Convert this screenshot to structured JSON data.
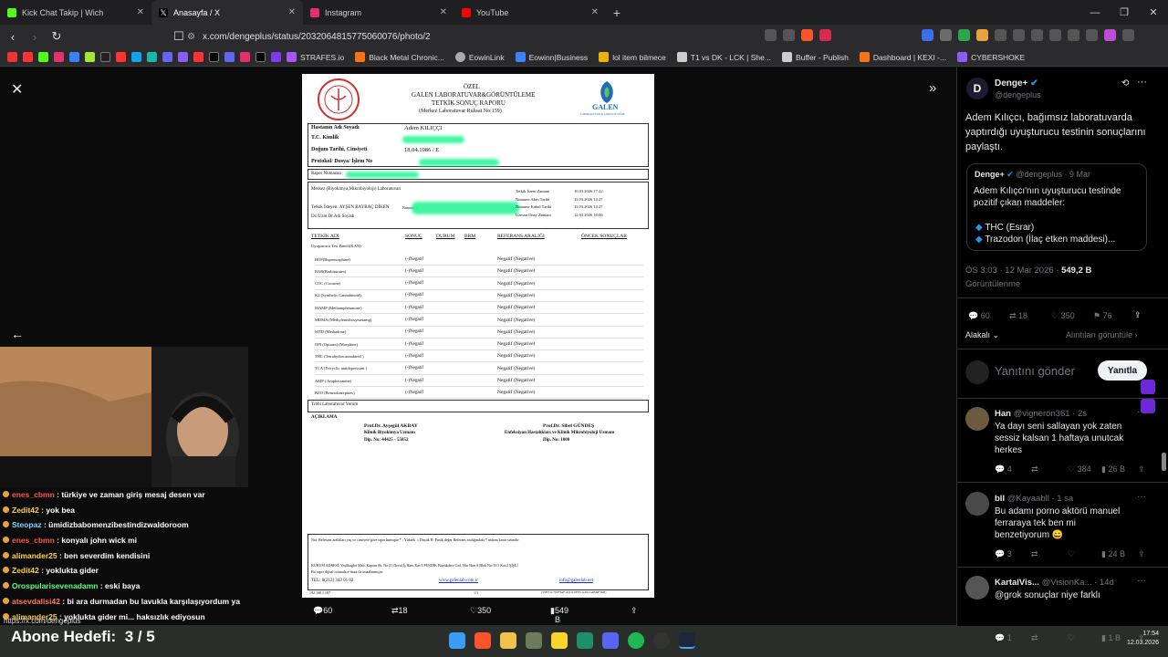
{
  "browser": {
    "tabs": [
      {
        "label": "Kick Chat Takip | Wich",
        "color": "#53fc18"
      },
      {
        "label": "Anasayfa / X",
        "color": "#ffffff"
      },
      {
        "label": "Instagram",
        "color": "#e1306c"
      },
      {
        "label": "YouTube",
        "color": "#ff0000"
      }
    ],
    "url": "x.com/dengeplus/status/2032064815775060076/photo/2",
    "bookmarks": [
      "STRAFES.io",
      "Black Metal Chronic...",
      "EowinLink",
      "Eowinn|Business",
      "lol item bilmece",
      "T1 vs DK - LCK | She...",
      "Buffer - Publish",
      "Dashboard | KEXI -...",
      "CYBERSHOKE"
    ]
  },
  "report": {
    "header": [
      "ÖZEL",
      "GALEN LABORATUVAR&GÖRÜNTÜLEME",
      "TETKİK SONUÇ RAPORU",
      "(Merkez Laboratuvar Ruhsat No:159)"
    ],
    "logo_text": "GALEN",
    "logo_sub": "LABORATUVAR & GÖRÜNTÜLEME",
    "patient_labels": [
      "Hastanın Adı Soyadı",
      "T.C. Kimlik",
      "Doğum Tarihi, Cinsiyeti",
      "Protokol/ Dosya/ İşlem No"
    ],
    "patient_name": "Adem KILIÇÇI",
    "patient_dob": "18.04.1986 /   E",
    "report_no": "Rapor Numarası",
    "lab": "Merkez (Biyokimya,Mikrobiyoloji) Laboratuvarı",
    "requester": "Tetkik İsteyen: AYŞEN BAYRAÇ DİKEN",
    "requester_extra": "Numune T.",
    "doctor": "Dr./Uzm.Dr.Adı Soyadı",
    "times": [
      {
        "label": "Tetkik İstem Zamanı",
        "value": "10.03.2026 17:22"
      },
      {
        "label": "Numune Alım Tarihi",
        "value": "11.03.2026 14:27"
      },
      {
        "label": "Numune Kabul Tarihi",
        "value": "11.03.2026 14:27"
      },
      {
        "label": "Uzman Onay Zamanı",
        "value": "12.03.2026 10:06"
      }
    ],
    "columns": [
      "TETKİK ADI",
      "SONUÇ",
      "DURUM",
      "BRM",
      "REFERANS ARALIĞI",
      "ÖNCEK SONUÇLAR"
    ],
    "panel": "Uyuşturucu Test Paneli(KAN)",
    "tests": [
      "BUP(Buprenorphine)",
      "BAR(Barbiturates)",
      "COC (Cocaine)",
      "K2 (Synthetic Cannabinoid)",
      "MAMP (Methamphetamine)",
      "MDMA (Methylenedioxymetamp)",
      "MTD (Methadone)",
      "OPI (Opiates) (Morphine)",
      "THC (Tetrahydrocannabinol )",
      "TCA (Tricyclic antidepressant )",
      "AMP ( Amphetamine)",
      "BZO (Benzodiazepines)"
    ],
    "result": "(-)Negatif",
    "reference": "Negatif (Negative)",
    "footer_row": "Tıbbi Laboratuvar Yorum",
    "aciklama": "AÇIKLAMA",
    "sign1": [
      "Prof.Dr. Ayşegül AKBAY",
      "Klinik Biyokimya Uzmanı",
      "Dip. No: 44425 - 55852"
    ],
    "sign2": [
      "Prof.Dr. Sibel GÜNDEŞ",
      "Enfeksiyon Hastalıkları ve Klinik Mikrobiyoloji Uzmanı",
      "Dip. No: 1000"
    ],
    "note": "Not: Referans aralıkları yaş ve cinsiyete göre raporlanmıştır   * : Yüksek   ↓: Düşük   H: Panik değer   Referans aralığındaki * anlamı karar sınırıdır",
    "kurum": "KURUM ADRESİ:  Yeşilbağlar Mah. Kaptan Sk. No:21 Deval İş Hanı Kat:3 PENDİK     Büyükdere Cad. Hür Han A Blok No:15/1 Kat:2 ŞİŞLİ",
    "kurum2": "Bu rapor dijital ortamda e-imza ile imzalanmıştır.",
    "tel": "TEL:  0(212) 343 01 02",
    "web": "www.galenlab.com.tr",
    "email": "info@galenlab.net",
    "ip": "192.168.1.187",
    "page": "1/1",
    "hash": "{95B71C78-F8AE-45C9-8F93-A45C1ABDF3D8}"
  },
  "post_actions": {
    "replies": "60",
    "reposts": "18",
    "likes": "350",
    "views": "549 B"
  },
  "stream": {
    "chat": [
      {
        "user": "enes_cbmn",
        "msg": " : türkiye ve zaman giriş mesaj desen var",
        "color": "#ff5555"
      },
      {
        "user": "Zedit42",
        "msg": " : yok bea",
        "color": "#ffd24d"
      },
      {
        "user": "Steopaz",
        "msg": " : ümidizbabomenzibestindizwaldoroom",
        "color": "#7fd4ff"
      },
      {
        "user": "enes_cbmn",
        "msg": " : konyalı john wick mi",
        "color": "#ff5555"
      },
      {
        "user": "alimander25",
        "msg": " : ben severdim kendisini",
        "color": "#ffd24d"
      },
      {
        "user": "Zedit42",
        "msg": " : yoklukta gider",
        "color": "#ffd24d"
      },
      {
        "user": "Orospularisevenadamn",
        "msg": " : eski baya",
        "color": "#5cff8a"
      },
      {
        "user": "atsevdalisi42",
        "msg": " : bi ara durmadan bu lavukla karşılaşıyordum ya",
        "color": "#ff7a5c"
      },
      {
        "user": "alimander25",
        "msg": " : yoklukta gider mi... haksızlık ediyosun",
        "color": "#ffd24d"
      }
    ],
    "status_url": "https://x.com/dengeplus",
    "goal_label": "Abone Hedefi:",
    "goal_value": "3 / 5"
  },
  "system": {
    "time": "17:54",
    "date": "12.03.2026"
  },
  "sidebar": {
    "author": "Denge+",
    "handle": "@dengeplus",
    "text": "Adem Kılıçcı, bağımsız laboratuvarda yaptırdığı uyuşturucu testinin sonuçlarını paylaştı.",
    "quote": {
      "author": "Denge+",
      "meta": "@dengeplus · 9 Mar",
      "text": "Adem Kılıçcı'nın uyuşturucu testinde pozitif çıkan maddeler:",
      "items": [
        "THC (Esrar)",
        "Trazodon (İlaç etken maddesi)..."
      ]
    },
    "time": "ÖS 3:03 · 12 Mar 2026 · ",
    "views_count": "549,2 B",
    "views_label": "Görüntülenme",
    "stats": {
      "replies": "60",
      "reposts": "18",
      "likes": "350",
      "bookmarks": "76"
    },
    "sort": "Alakalı",
    "quotes_link": "Alıntıları görüntüle",
    "reply_placeholder": "Yanıtını gönder",
    "reply_button": "Yanıtla",
    "replies": [
      {
        "name": "Han",
        "handle": "@vigneron361 · 2s",
        "text": "Ya dayı seni sallayan yok zaten sessiz kalsan 1 haftaya unutcak herkes",
        "stats": [
          "4",
          "",
          "384",
          "26 B"
        ]
      },
      {
        "name": "bll",
        "handle": "@Kayaabll · 1 sa",
        "text": "Bu adamı porno aktörü manuel ferraraya tek ben mi benzetiyorum 😄",
        "stats": [
          "3",
          "",
          "",
          "24 B"
        ]
      },
      {
        "name": "KartalVis...",
        "handle": "@VisionKa... · 14d",
        "text": "@grok sonuçlar niye farklı",
        "stats": [
          "1",
          "",
          "",
          "1 B"
        ]
      }
    ]
  },
  "colors": {
    "accent": "#1d9bf0",
    "green": "#2df59a"
  }
}
